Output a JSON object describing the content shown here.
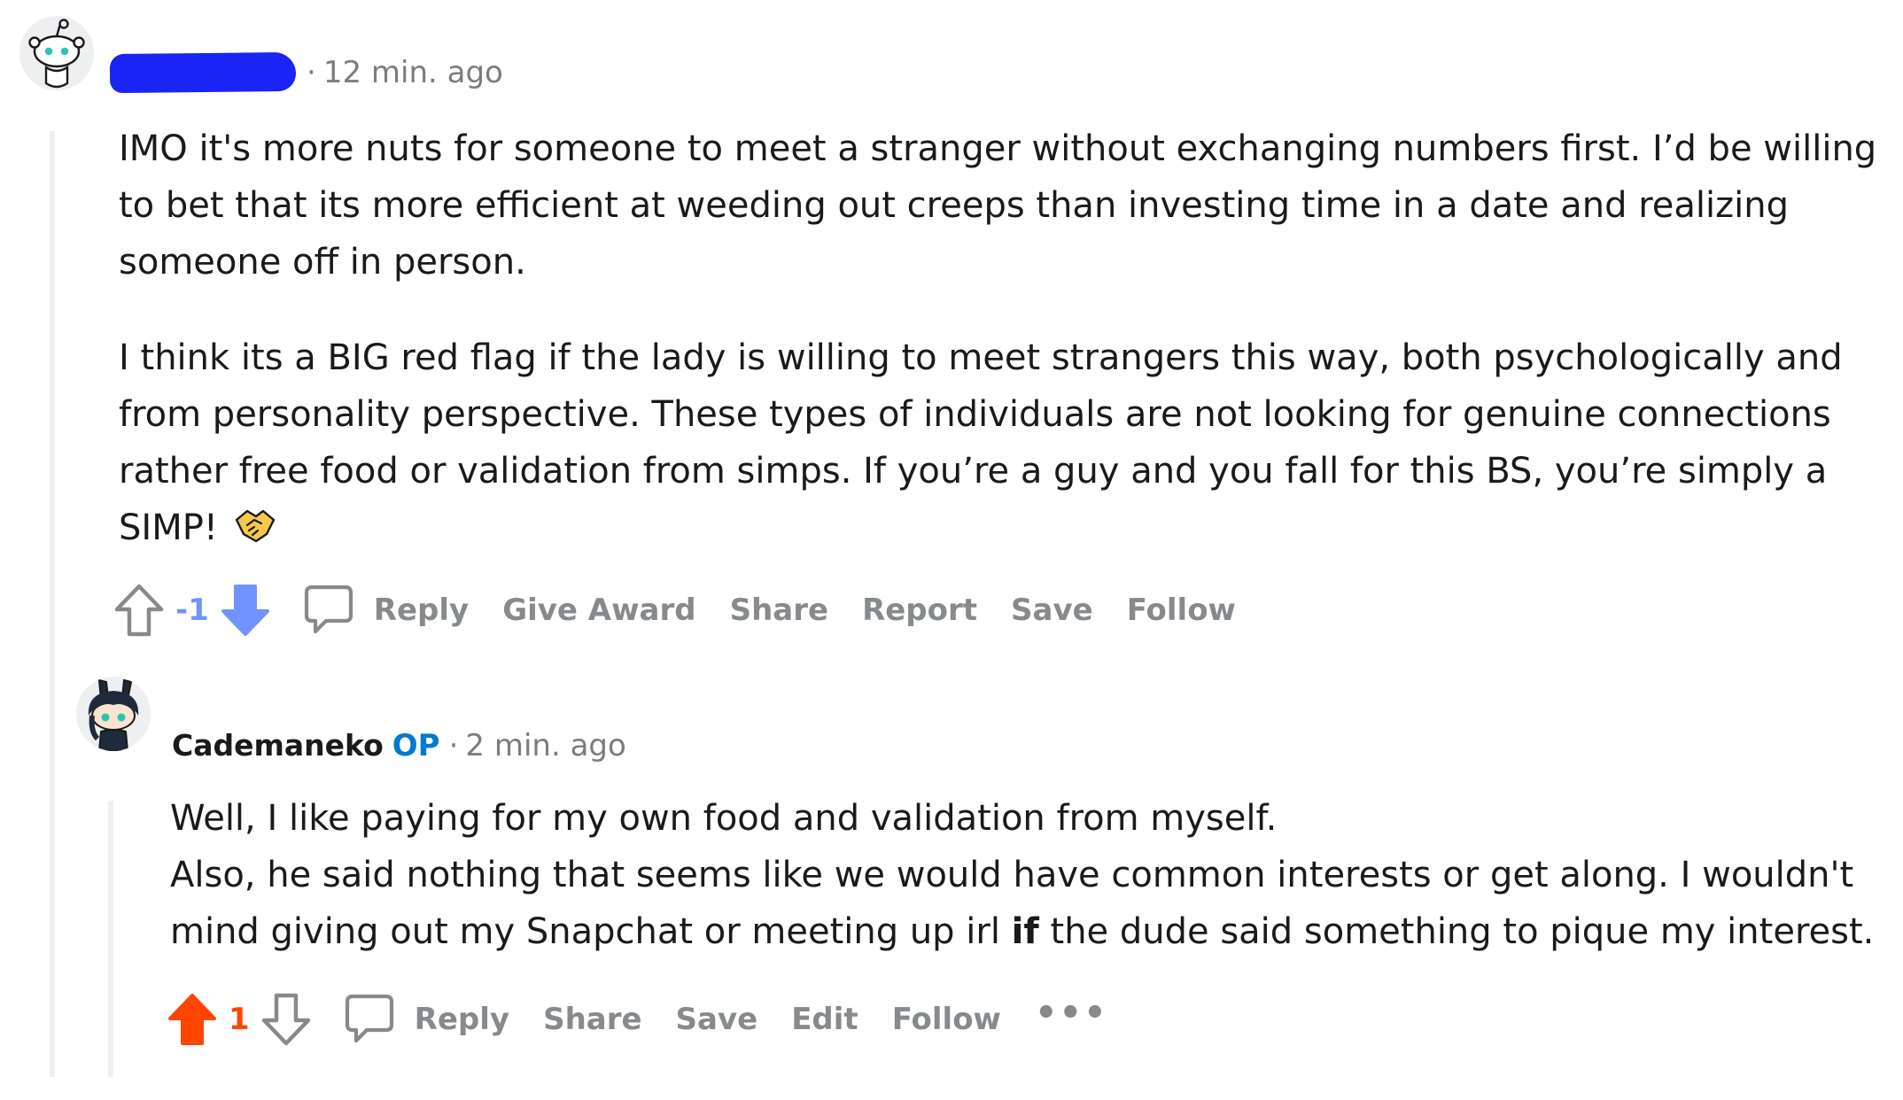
{
  "comments": [
    {
      "author_redacted": true,
      "timestamp": "12 min. ago",
      "paragraphs": [
        "IMO it's more nuts for someone to meet a stranger without exchanging numbers first. I’d be willing to bet that its more efficient at weeding out creeps than investing time in a date and realizing someone off in person.",
        "I think its a BIG red flag if the lady is willing to meet strangers this way, both psychologically and from personality perspective. These types of individuals are not looking for genuine connections rather free food or validation from simps. If you’re a guy and you fall for this BS, you’re simply a SIMP! "
      ],
      "emoji": "handshake",
      "vote_count": "-1",
      "vote_state": "downvoted",
      "vote_color": "#7193ff",
      "actions": {
        "reply": "Reply",
        "give_award": "Give Award",
        "share": "Share",
        "report": "Report",
        "save": "Save",
        "follow": "Follow"
      }
    },
    {
      "author": "Cademaneko",
      "op_badge": "OP",
      "timestamp": "2 min. ago",
      "lines": {
        "line1": "Well, I like paying for my own food and validation from myself.",
        "line2": "Also, he said nothing that seems like we would have common interests or get along. I wouldn't mind giving out my Snapchat or meeting up irl ",
        "bold": "if",
        "line2_end": " the dude said something to pique my interest."
      },
      "vote_count": "1",
      "vote_state": "upvoted",
      "vote_color": "#ff4500",
      "actions": {
        "reply": "Reply",
        "share": "Share",
        "save": "Save",
        "edit": "Edit",
        "follow": "Follow",
        "more": "•••"
      }
    }
  ],
  "meta_separator": "·",
  "colors": {
    "upvote": "#ff4500",
    "downvote": "#7193ff",
    "op": "#0079d3",
    "action_gray": "#878a8c",
    "thread_line": "#edeff1",
    "redaction": "#1a24f5"
  }
}
